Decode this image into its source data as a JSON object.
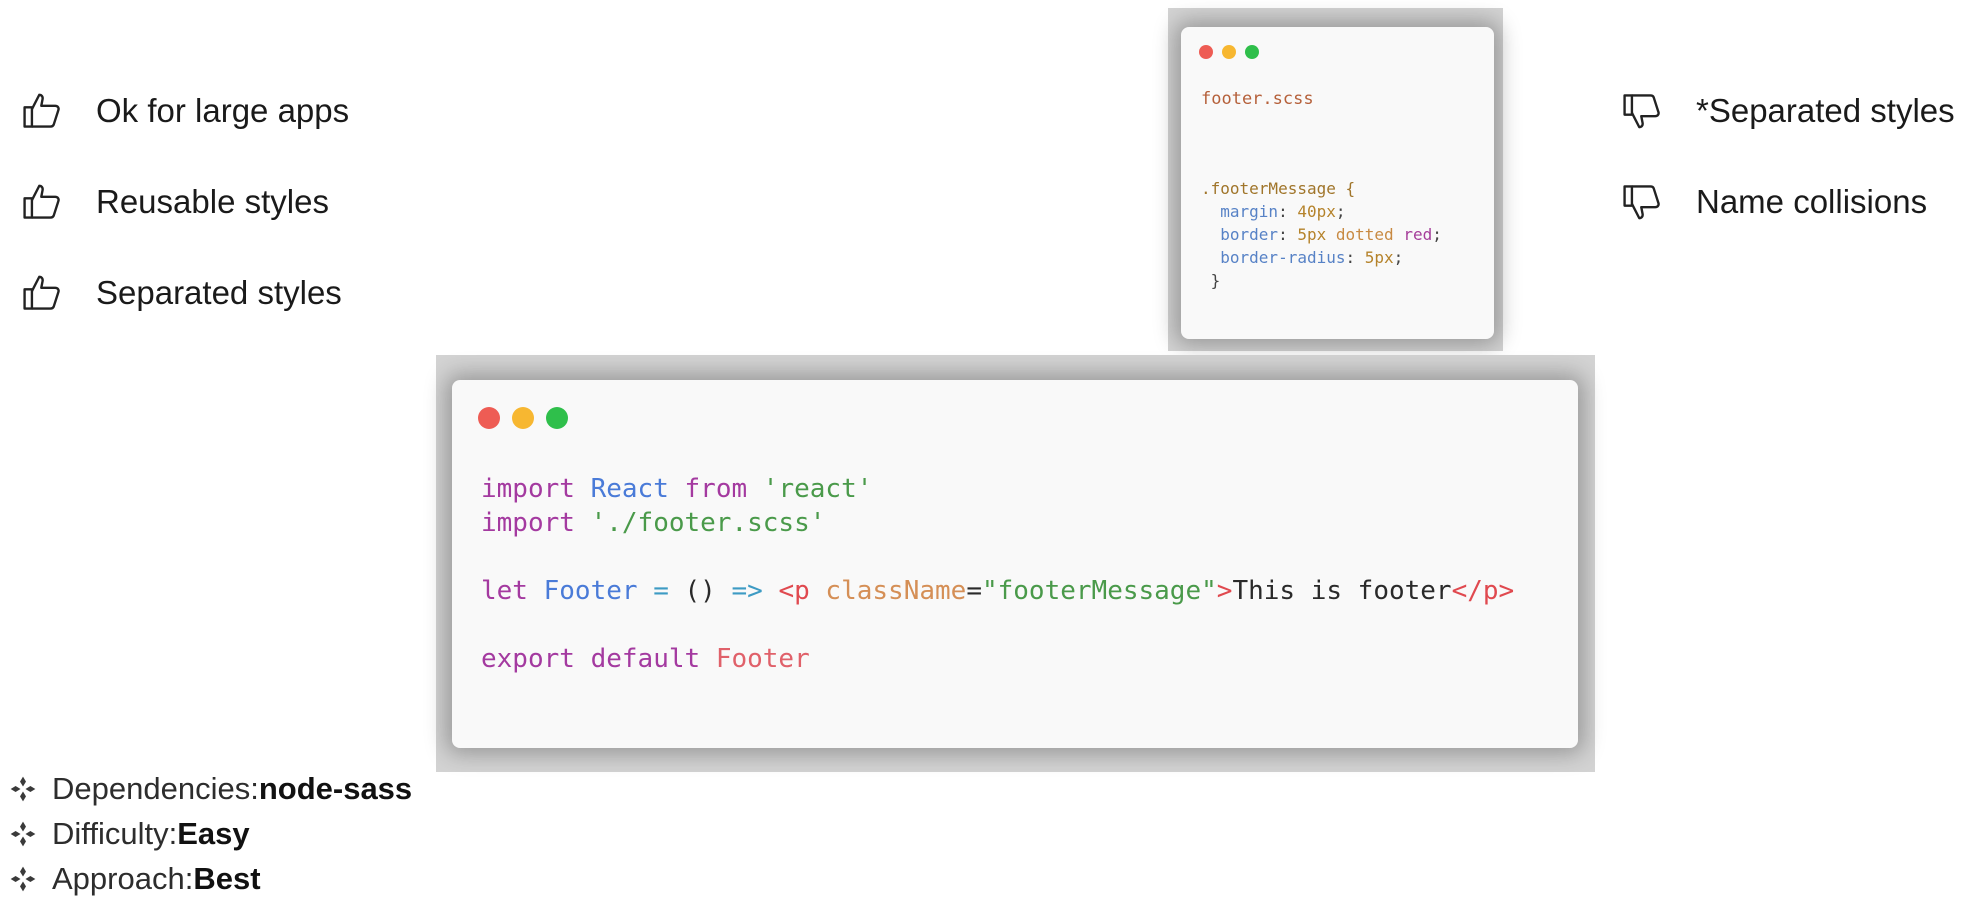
{
  "pros": [
    {
      "icon": "thumbs-up-icon",
      "text": "Ok for large apps"
    },
    {
      "icon": "thumbs-up-icon",
      "text": "Reusable styles"
    },
    {
      "icon": "thumbs-up-icon",
      "text": "Separated styles"
    }
  ],
  "cons": [
    {
      "icon": "thumbs-down-icon",
      "text": "*Separated styles"
    },
    {
      "icon": "thumbs-down-icon",
      "text": "Name collisions"
    }
  ],
  "window_dot_colors": [
    "#ee5c54",
    "#f7b731",
    "#2fbf4b"
  ],
  "scss_snippet": {
    "filename": "footer.scss",
    "selector": ".footerMessage {",
    "margin_prop": "margin",
    "margin_value": "40px",
    "border_prop": "border",
    "border_width": "5px",
    "border_style": "dotted",
    "border_color": "red",
    "radius_prop": "border-radius",
    "radius_value": "5px",
    "close": "}"
  },
  "js_snippet": {
    "kw_import": "import",
    "react_id": "React",
    "kw_from": "from",
    "react_str": "'react'",
    "scss_str": "'./footer.scss'",
    "kw_let": "let",
    "footer_id": "Footer",
    "eq": "=",
    "parens": "()",
    "arrow": "=>",
    "open_tag": "<p",
    "attr_name": "className",
    "attr_eq": "=",
    "attr_value": "\"footerMessage\"",
    "tag_close": ">",
    "inner_text": "This is footer",
    "close_tag": "</p>",
    "kw_export": "export",
    "kw_default": "default",
    "export_id": "Footer"
  },
  "facts": [
    {
      "label": "Dependencies: ",
      "value": "node-sass"
    },
    {
      "label": "Difficulty: ",
      "value": "Easy"
    },
    {
      "label": "Approach: ",
      "value": "Best"
    }
  ]
}
